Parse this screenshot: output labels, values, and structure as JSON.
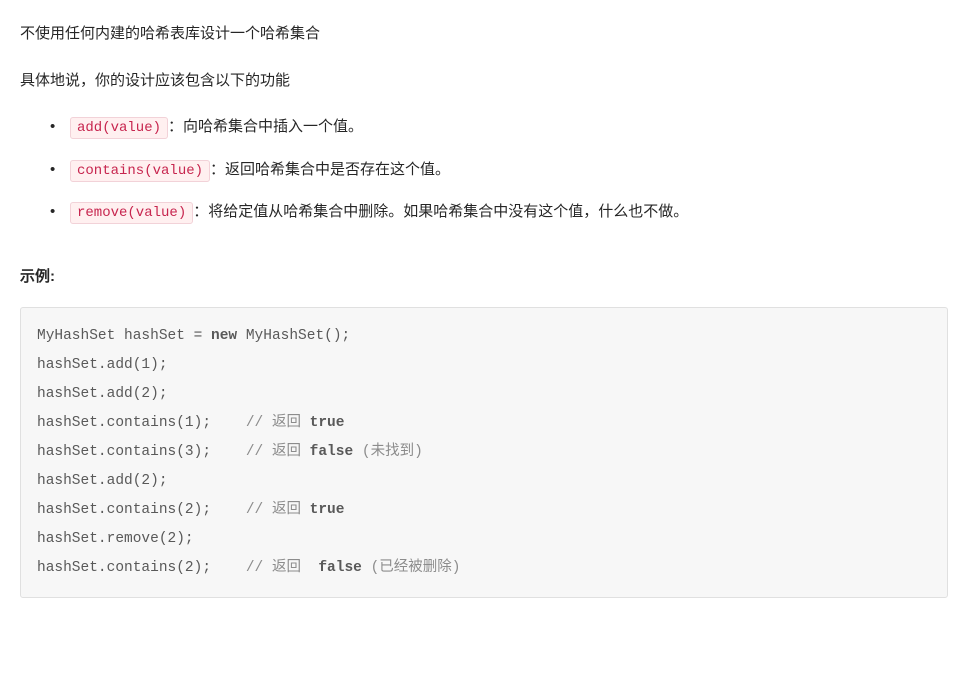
{
  "intro_para": "不使用任何内建的哈希表库设计一个哈希集合",
  "desc_para": "具体地说，你的设计应该包含以下的功能",
  "bullets": [
    {
      "code": "add(value)",
      "text": "：向哈希集合中插入一个值。"
    },
    {
      "code": "contains(value)",
      "text": "：返回哈希集合中是否存在这个值。"
    },
    {
      "code": "remove(value)",
      "text": "：将给定值从哈希集合中删除。如果哈希集合中没有这个值，什么也不做。"
    }
  ],
  "example_heading": "示例:",
  "codeblock": {
    "l1": "MyHashSet hashSet = ",
    "l1_kw": "new",
    "l1_rest": " MyHashSet();",
    "l2": "hashSet.add(1);         ",
    "l3": "hashSet.add(2);         ",
    "l4": "hashSet.contains(1);    ",
    "l4_comment": "// 返回 ",
    "l4_bool": "true",
    "l5": "hashSet.contains(3);    ",
    "l5_comment": "// 返回 ",
    "l5_bool": "false",
    "l5_comment2": " (未找到)",
    "l6": "hashSet.add(2);          ",
    "l7": "hashSet.contains(2);    ",
    "l7_comment": "// 返回 ",
    "l7_bool": "true",
    "l8": "hashSet.remove(2);          ",
    "l9": "hashSet.contains(2);    ",
    "l9_comment": "// 返回  ",
    "l9_bool": "false",
    "l9_comment2": " (已经被删除)"
  }
}
